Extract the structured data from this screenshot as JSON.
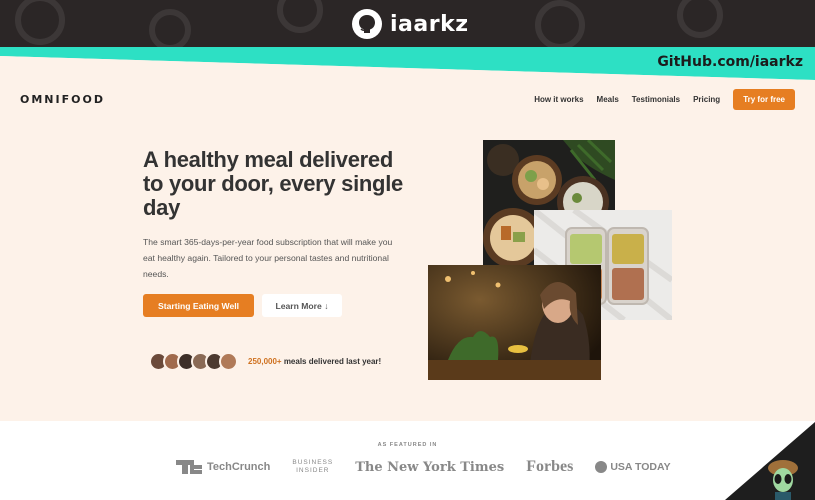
{
  "banner": {
    "username": "iaarkz",
    "github_link": "GitHub.com/iaarkz"
  },
  "nav": {
    "logo": "OMNIFOOD",
    "items": [
      "How it works",
      "Meals",
      "Testimonials",
      "Pricing"
    ],
    "cta": "Try for free"
  },
  "hero": {
    "title": "A healthy meal delivered to your door, every single day",
    "description": "The smart 365-days-per-year food subscription that will make you eat healthy again. Tailored to your personal tastes and nutritional needs.",
    "primary_button": "Starting Eating Well",
    "secondary_button": "Learn More ↓",
    "delivered_count": "250,000+",
    "delivered_text": " meals delivered last year!"
  },
  "featured": {
    "label": "AS FEATURED IN",
    "logos": {
      "techcrunch": "TechCrunch",
      "business_insider_line1": "BUSINESS",
      "business_insider_line2": "INSIDER",
      "nyt": "The New York Times",
      "forbes": "Forbes",
      "usatoday": "USA TODAY"
    }
  },
  "colors": {
    "accent": "#e67e22",
    "teal": "#2de0c4",
    "background": "#fdf2e9",
    "dark": "#2b2626"
  }
}
